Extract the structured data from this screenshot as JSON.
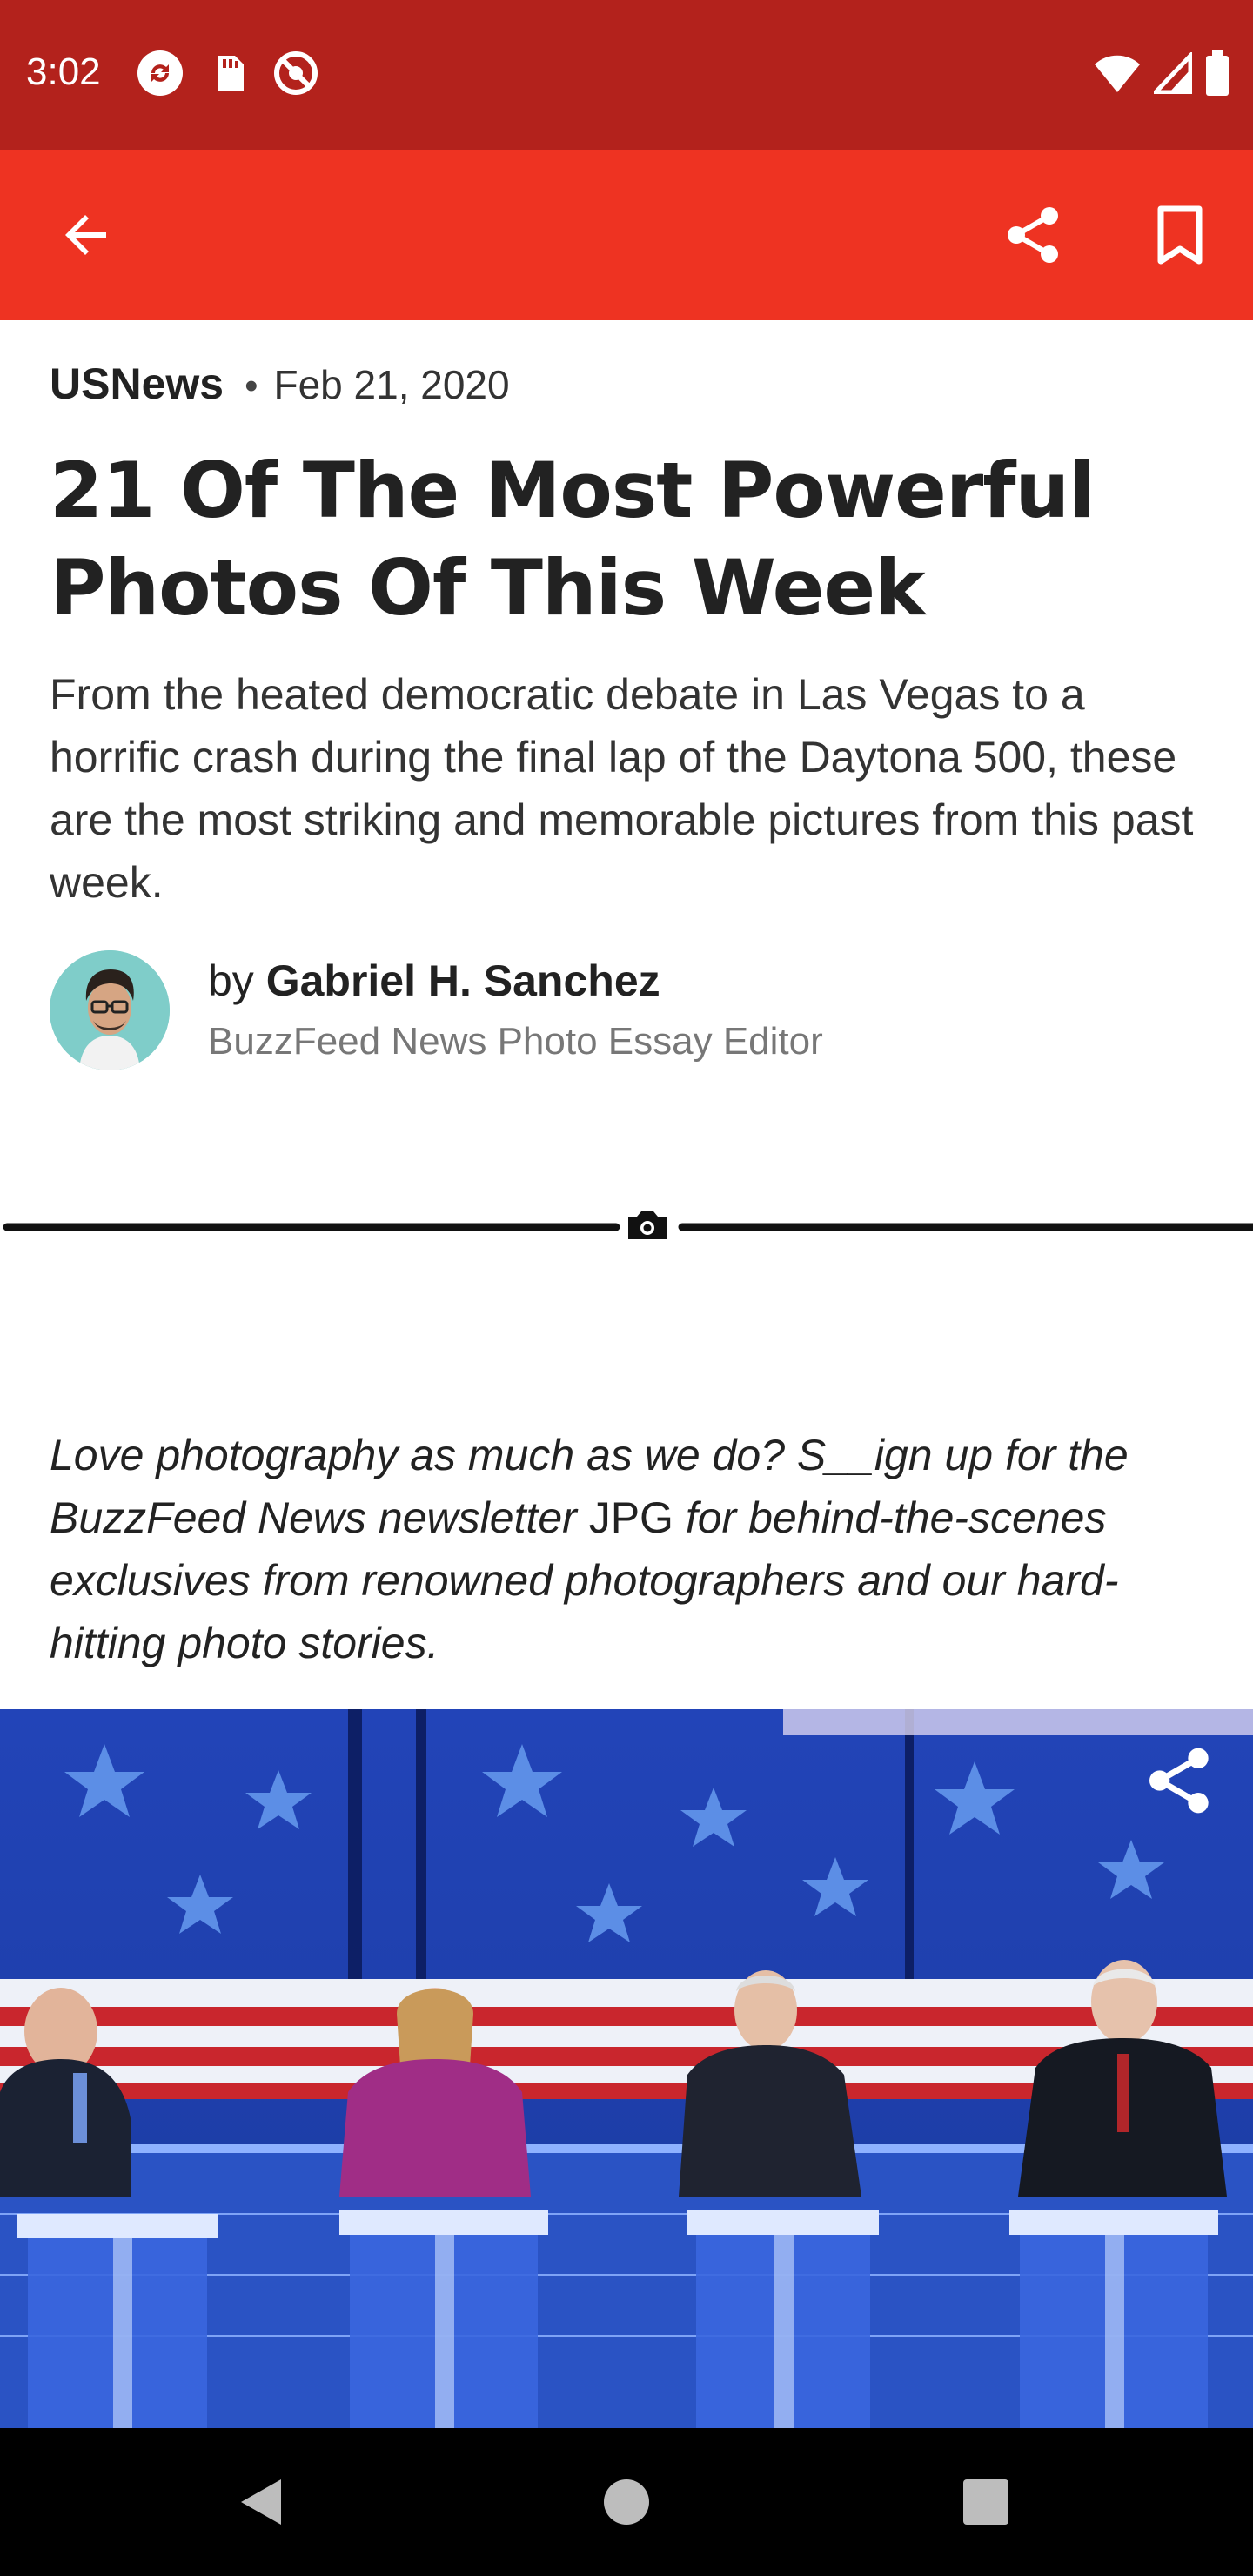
{
  "status_bar": {
    "time": "3:02",
    "left_icons": [
      "sync-icon",
      "sd-card-icon",
      "do-not-disturb-icon"
    ],
    "right_icons": [
      "wifi-icon",
      "cell-signal-icon",
      "battery-icon"
    ]
  },
  "app_bar": {
    "background": "#ee3322",
    "back_icon": "arrow-back-icon",
    "share_icon": "share-icon",
    "bookmark_icon": "bookmark-icon"
  },
  "article": {
    "source": "USNews",
    "separator": "•",
    "date": "Feb 21, 2020",
    "headline": "21 Of The Most Powerful Photos Of This Week",
    "dek": "From the heated democratic debate in Las Vegas to a horrific crash during the final lap of the Daytona 500, these are the most striking and memorable pictures from this past week.",
    "byline": {
      "prefix": "by ",
      "author": "Gabriel H. Sanchez",
      "title": "BuzzFeed News Photo Essay Editor"
    },
    "divider_icon": "camera-icon",
    "newsletter": {
      "part1": "Love photography as much as we do? S__ign up for the BuzzFeed News newsletter ",
      "part2": "JPG",
      "part3": " for behind-the-scenes exclusives from renowned photographers and our hard-hitting photo stories."
    },
    "photo": {
      "share_icon": "share-icon"
    }
  },
  "nav_bar": {
    "back_icon": "nav-back-icon",
    "home_icon": "nav-home-icon",
    "recents_icon": "nav-recents-icon"
  }
}
